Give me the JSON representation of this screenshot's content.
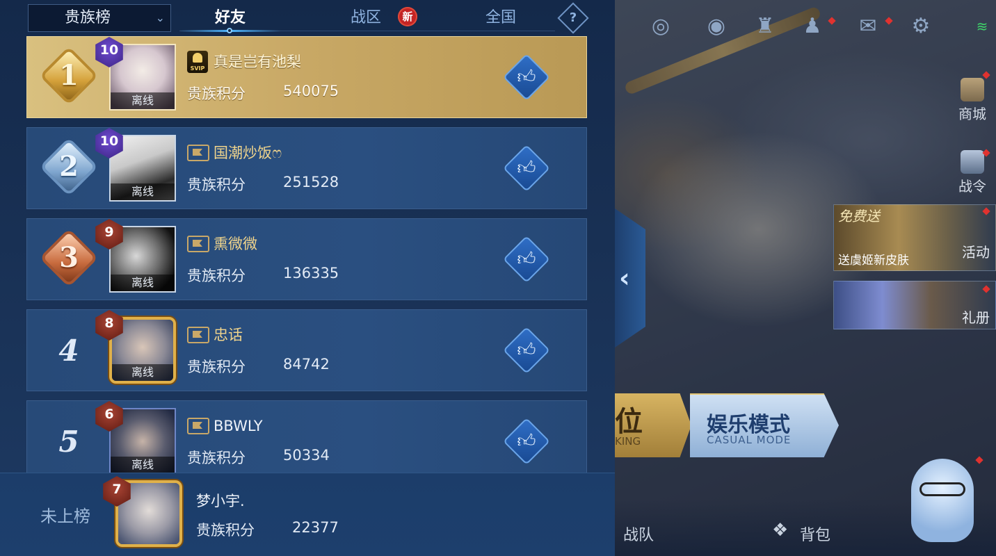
{
  "leaderboard": {
    "category_dropdown": {
      "label": "贵族榜"
    },
    "tabs": [
      {
        "label": "好友",
        "active": true
      },
      {
        "label": "战区",
        "active": false,
        "badge": "新"
      },
      {
        "label": "全国",
        "active": false
      }
    ],
    "help_label": "?",
    "entries": [
      {
        "rank": "1",
        "level": "10",
        "name": "真是岂有池梨",
        "icon": "svip-icon",
        "status": "离线",
        "score_label": "贵族积分",
        "score": "540075",
        "rank_style": "gold"
      },
      {
        "rank": "2",
        "level": "10",
        "name": "国潮炒饭ෆ",
        "icon": "flag-icon",
        "status": "离线",
        "score_label": "贵族积分",
        "score": "251528",
        "rank_style": "silver"
      },
      {
        "rank": "3",
        "level": "9",
        "name": "熏微微",
        "icon": "flag-icon",
        "status": "离线",
        "score_label": "贵族积分",
        "score": "136335",
        "rank_style": "bronze"
      },
      {
        "rank": "4",
        "level": "8",
        "name": "忠话",
        "icon": "flag-icon",
        "status": "离线",
        "score_label": "贵族积分",
        "score": "84742",
        "rank_style": "plain"
      },
      {
        "rank": "5",
        "level": "6",
        "name": "BBWLY",
        "icon": "flag-icon",
        "status": "离线",
        "score_label": "贵族积分",
        "score": "50334",
        "rank_style": "plain"
      }
    ],
    "self": {
      "rank_text": "未上榜",
      "level": "7",
      "name": "梦小宇.",
      "score_label": "贵族积分",
      "score": "22377"
    }
  },
  "lobby": {
    "side_buttons": [
      {
        "label": "商城",
        "icon": "shop-icon"
      },
      {
        "label": "战令",
        "icon": "battle-pass-icon"
      },
      {
        "label": "活动",
        "icon": "event-chest-icon"
      },
      {
        "label": "礼册",
        "icon": "gift-book-icon"
      }
    ],
    "promo_a": {
      "top": "免费送",
      "text": "送虞姬新皮肤"
    },
    "modes": {
      "rank_big": "位",
      "rank_small": "KING",
      "casual_big": "娱乐模式",
      "casual_small": "CASUAL MODE"
    },
    "bottom": {
      "team": "战队",
      "backpack": "背包"
    },
    "top_icons": [
      "emblem-icon",
      "eye-icon",
      "trophy-icon",
      "friends-icon",
      "mail-icon",
      "gear-icon",
      "wifi-icon"
    ]
  },
  "colors": {
    "accent": "#4fb6ff",
    "gold_row": "#c8a865",
    "row_bg": "#2a4f80",
    "red_dot": "#e0322f"
  }
}
